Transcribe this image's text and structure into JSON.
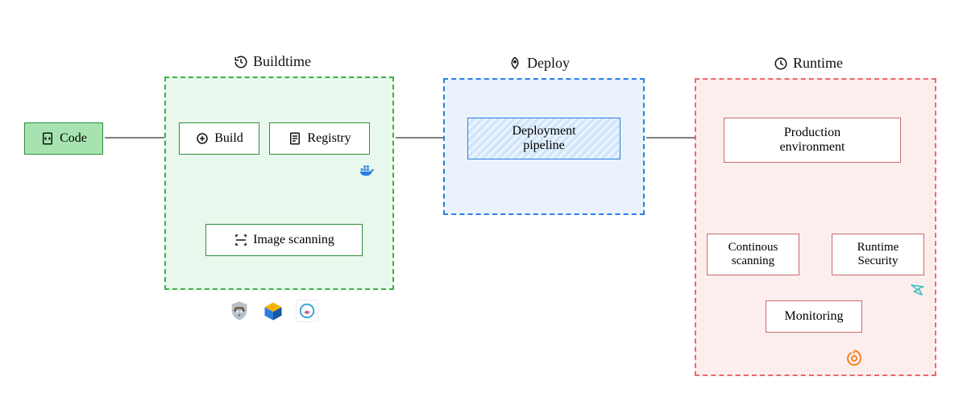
{
  "labels": {
    "code": "Code",
    "buildtime": "Buildtime",
    "build": "Build",
    "registry": "Registry",
    "image_scanning": "Image scanning",
    "deploy": "Deploy",
    "deployment_pipeline": "Deployment\npipeline",
    "runtime": "Runtime",
    "production_environment": "Production\nenvironment",
    "continuous_scanning": "Continous\nscanning",
    "runtime_security": "Runtime\nSecurity",
    "monitoring": "Monitoring"
  },
  "icons": {
    "code": "code-file-icon",
    "buildtime": "history-icon",
    "build": "target-plus-icon",
    "registry": "list-file-icon",
    "image_scanning": "scan-icon",
    "deploy": "rocket-icon",
    "runtime": "clock-icon",
    "docker": "docker-icon",
    "anchore": "dog-shield-icon",
    "clair": "cube-icon",
    "sysdig": "scope-icon",
    "falco": "falco-icon",
    "grafana": "grafana-icon"
  },
  "colors": {
    "green": "#3bb143",
    "green_fill": "#a7e3b1",
    "green_panel": "#e9f8ed",
    "blue": "#2a7de1",
    "blue_panel": "#eaf3fd",
    "red": "#e86a6a",
    "red_panel": "#fdeeee"
  },
  "flow": [
    [
      "code",
      "build"
    ],
    [
      "build",
      "image_scanning"
    ],
    [
      "image_scanning",
      "registry"
    ],
    [
      "registry",
      "deployment_pipeline"
    ],
    [
      "deployment_pipeline",
      "production_environment"
    ],
    [
      "continuous_scanning",
      "production_environment"
    ],
    [
      "monitoring",
      "production_environment"
    ],
    [
      "runtime_security",
      "production_environment"
    ]
  ]
}
